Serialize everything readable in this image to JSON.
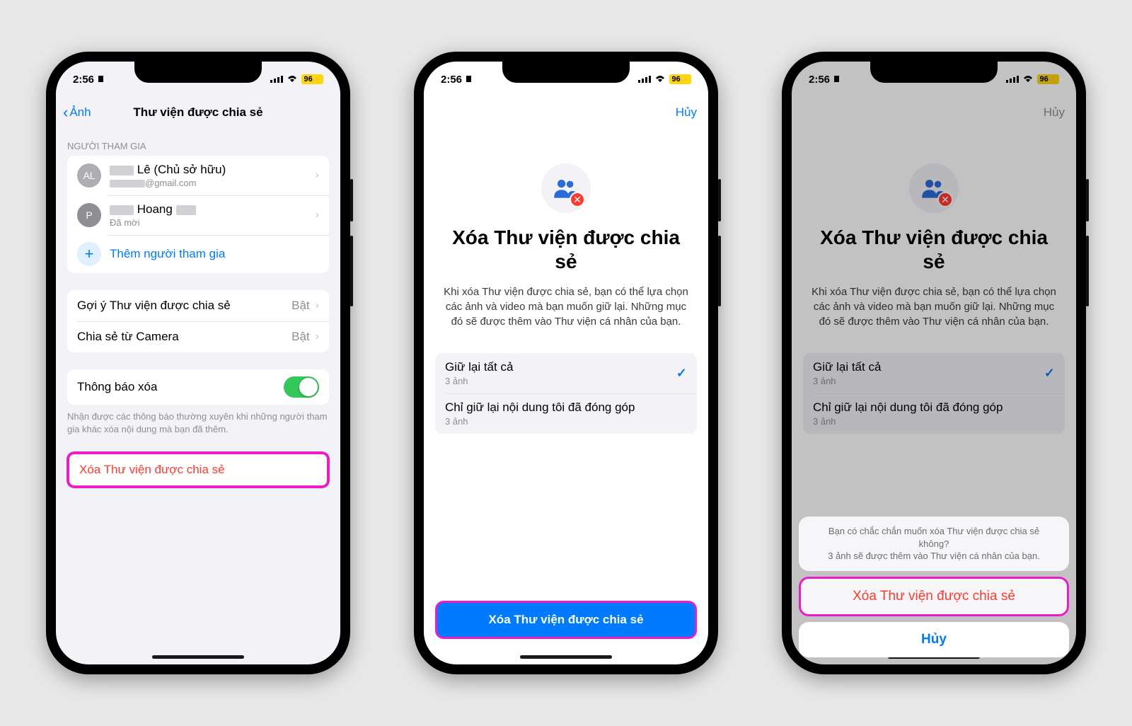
{
  "statusbar": {
    "time": "2:56",
    "battery": "96"
  },
  "colors": {
    "link": "#007aff",
    "destructive": "#ff3b30",
    "highlight": "#e91ec9",
    "toggle_on": "#34c759"
  },
  "screen1": {
    "back_label": "Ảnh",
    "title": "Thư viện được chia sẻ",
    "participants_header": "NGƯỜI THAM GIA",
    "participants": [
      {
        "avatar": "AL",
        "name_suffix": "Lê (Chủ sở hữu)",
        "sub_suffix": "@gmail.com"
      },
      {
        "avatar": "P",
        "name_suffix": "Hoang",
        "sub": "Đã mời"
      }
    ],
    "add_participant": "Thêm người tham gia",
    "suggestions_row": {
      "label": "Gợi ý Thư viện được chia sẻ",
      "value": "Bật"
    },
    "camera_row": {
      "label": "Chia sẻ từ Camera",
      "value": "Bật"
    },
    "notify_row": {
      "label": "Thông báo xóa"
    },
    "notify_footnote": "Nhận được các thông báo thường xuyên khi những người tham gia khác xóa nội dung mà bạn đã thêm.",
    "delete_button": "Xóa Thư viện được chia sẻ"
  },
  "screen2": {
    "cancel": "Hủy",
    "title": "Xóa Thư viện được chia sẻ",
    "body": "Khi xóa Thư viện được chia sẻ, bạn có thể lựa chọn các ảnh và video mà bạn muốn giữ lại. Những mục đó sẽ được thêm vào Thư viện cá nhân của bạn.",
    "options": [
      {
        "title": "Giữ lại tất cả",
        "sub": "3 ảnh",
        "selected": true
      },
      {
        "title": "Chỉ giữ lại nội dung tôi đã đóng góp",
        "sub": "3 ảnh",
        "selected": false
      }
    ],
    "primary_button": "Xóa Thư viện được chia sẻ"
  },
  "screen3": {
    "sheet": {
      "line1": "Bạn có chắc chắn muốn xóa Thư viện được chia sẻ không?",
      "line2": "3 ảnh sẽ được thêm vào Thư viện cá nhân của bạn.",
      "destructive": "Xóa Thư viện được chia sẻ",
      "cancel": "Hủy"
    }
  }
}
